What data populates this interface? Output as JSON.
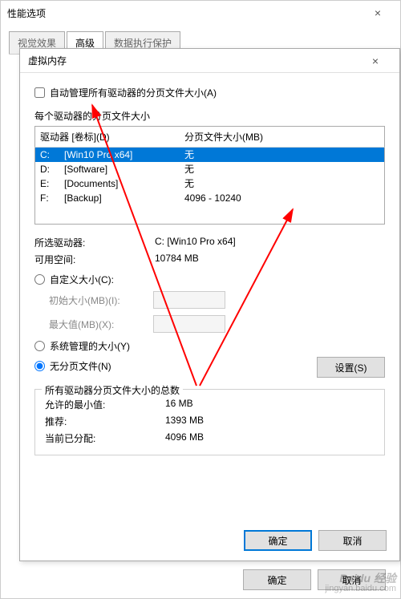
{
  "outer": {
    "title": "性能选项",
    "tabs": [
      "视觉效果",
      "高级",
      "数据执行保护"
    ],
    "ok": "确定",
    "cancel": "取消"
  },
  "inner": {
    "title": "虚拟内存",
    "auto_manage": "自动管理所有驱动器的分页文件大小(A)",
    "per_drive_label": "每个驱动器的分页文件大小",
    "col_drive": "驱动器 [卷标](D)",
    "col_size": "分页文件大小(MB)",
    "drives": [
      {
        "letter": "C:",
        "label": "[Win10 Pro x64]",
        "size": "无",
        "selected": true
      },
      {
        "letter": "D:",
        "label": "[Software]",
        "size": "无",
        "selected": false
      },
      {
        "letter": "E:",
        "label": "[Documents]",
        "size": "无",
        "selected": false
      },
      {
        "letter": "F:",
        "label": "[Backup]",
        "size": "4096 - 10240",
        "selected": false
      }
    ],
    "selected_drive_label": "所选驱动器:",
    "selected_drive_value": "C:  [Win10 Pro x64]",
    "available_label": "可用空间:",
    "available_value": "10784 MB",
    "custom_size": "自定义大小(C):",
    "initial_size": "初始大小(MB)(I):",
    "max_size": "最大值(MB)(X):",
    "system_managed": "系统管理的大小(Y)",
    "no_paging": "无分页文件(N)",
    "set_btn": "设置(S)",
    "total_group": "所有驱动器分页文件大小的总数",
    "min_allowed_label": "允许的最小值:",
    "min_allowed_value": "16 MB",
    "recommended_label": "推荐:",
    "recommended_value": "1393 MB",
    "allocated_label": "当前已分配:",
    "allocated_value": "4096 MB",
    "ok": "确定",
    "cancel": "取消"
  },
  "watermark": {
    "brand": "Baidu 经验",
    "url": "jingyan.baidu.com"
  }
}
